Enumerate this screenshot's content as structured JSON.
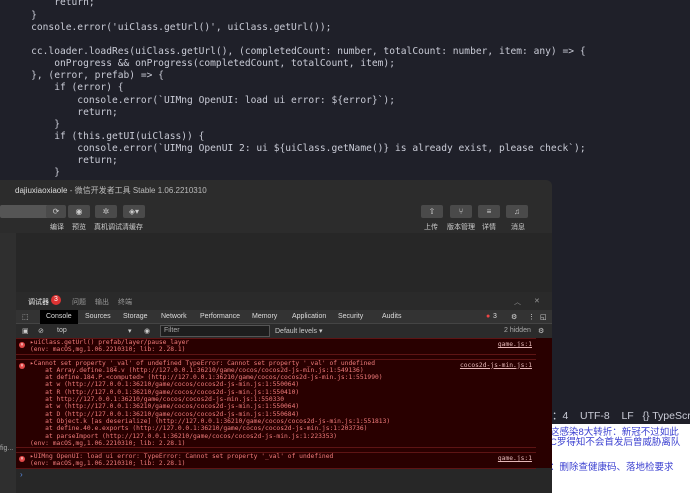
{
  "editor": {
    "lines": [
      [
        "        return;"
      ],
      [
        "    }"
      ],
      [
        "    console.error('uiClass.getUrl()', uiClass.getUrl());"
      ],
      [
        ""
      ],
      [
        "    cc.loader.loadRes(uiClass.getUrl(), (completedCount: number, totalCount: number, item: any) => {"
      ],
      [
        "        onProgress && onProgress(completedCount, totalCount, item);"
      ],
      [
        "    }, (error, prefab) => {"
      ],
      [
        "        if (error) {"
      ],
      [
        "            console.error(`UIMng OpenUI: load ui error: ${error}`);"
      ],
      [
        "            return;"
      ],
      [
        "        }"
      ],
      [
        "        if (this.getUI(uiClass)) {"
      ],
      [
        "            console.error(`UIMng OpenUI 2: ui ${uiClass.getName()} is already exist, please check`);"
      ],
      [
        "            return;"
      ],
      [
        "        }"
      ]
    ],
    "status": {
      "col": "：4",
      "encoding": "UTF-8",
      "eol": "LF",
      "language": "{} TypeScript"
    }
  },
  "web_headlines": [
    "这感染8大转折：新冠不过如此",
    "C罗得知不会首发后曾威胁离队",
    "：删除查健康码、落地检要求"
  ],
  "window": {
    "title_user": "dajiuxiaoxiaole",
    "title_rest": " - 微信开发者工具 Stable 1.06.2210310",
    "toolbar_left": [
      "编译",
      "预览",
      "真机调试",
      "清缓存"
    ],
    "toolbar_right": [
      "上传",
      "版本管理",
      "详情",
      "消息"
    ],
    "sidebar_text": "fig..."
  },
  "debugger": {
    "tabs": [
      "调试器",
      "问题",
      "输出",
      "终端"
    ],
    "badge": "3"
  },
  "devtools": {
    "tabs": [
      "Console",
      "Sources",
      "Storage",
      "Network",
      "Performance",
      "Memory",
      "Application",
      "Security",
      "Audits"
    ],
    "error_count": "3",
    "context": "top",
    "filter_placeholder": "Filter",
    "levels": "Default levels ▾",
    "hidden": "2 hidden"
  },
  "console": {
    "messages": [
      {
        "lines": [
          "▸uiClass.getUrl() prefab/layer/pause_layer",
          "(env: macOS,mg,1.06.2210310; lib: 2.28.1)"
        ],
        "source": "game.js:1"
      },
      {
        "lines": [
          "▸Cannot set property '_val' of undefined TypeError: Cannot set property '_val' of undefined",
          "    at Array.define.184.v (http://127.0.0.1:36210/game/cocos/cocos2d-js-min.js:1:549136)",
          "    at define.184.P.<computed> (http://127.0.0.1:36210/game/cocos/cocos2d-js-min.js:1:551990)",
          "    at w (http://127.0.0.1:36210/game/cocos/cocos2d-js-min.js:1:550064)",
          "    at R (http://127.0.0.1:36210/game/cocos/cocos2d-js-min.js:1:550410)",
          "    at http://127.0.0.1:36210/game/cocos/cocos2d-js-min.js:1:550330",
          "    at w (http://127.0.0.1:36210/game/cocos/cocos2d-js-min.js:1:550064)",
          "    at D (http://127.0.0.1:36210/game/cocos/cocos2d-js-min.js:1:550684)",
          "    at Object.k [as deserialize] (http://127.0.0.1:36210/game/cocos/cocos2d-js-min.js:1:551813)",
          "    at define.40.e.exports (http://127.0.0.1:36210/game/cocos/cocos2d-js-min.js:1:203736)",
          "    at parseImport (http://127.0.0.1:36210/game/cocos/cocos2d-js-min.js:1:223353)",
          "(env: macOS,mg,1.06.2210310; lib: 2.28.1)"
        ],
        "source": "cocos2d-js-min.js:1"
      },
      {
        "lines": [
          "▸UIMng OpenUI: load ui error: TypeError: Cannot set property '_val' of undefined",
          "(env: macOS,mg,1.06.2210310; lib: 2.28.1)"
        ],
        "source": "game.js:1"
      }
    ],
    "prompt": "›"
  }
}
